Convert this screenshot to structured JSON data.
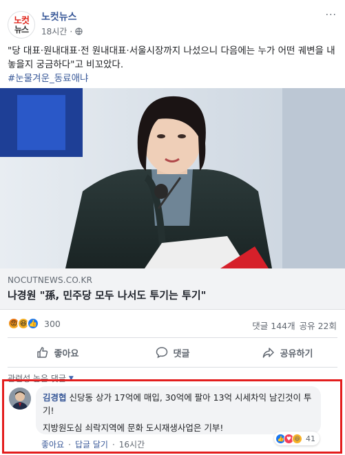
{
  "header": {
    "avatar_line1": "노컷",
    "avatar_line2": "뉴스",
    "page_name": "노컷뉴스",
    "time": "18시간",
    "more": "···"
  },
  "post": {
    "text": "\"당 대표·원내대표·전 원내대표·서울시장까지 나섰으니 다음에는 누가 어떤 궤변을 내놓을지 궁금하다\"고 비꼬았다.",
    "hashtag": "#눈물겨운_동료애냐"
  },
  "link": {
    "domain": "NOCUTNEWS.CO.KR",
    "title": "나경원 \"孫, 민주당 모두 나서도 투기는 투기\""
  },
  "stats": {
    "reaction_count": "300",
    "comments": "댓글 144개",
    "shares": "공유 22회"
  },
  "actions": {
    "like": "좋아요",
    "comment": "댓글",
    "share": "공유하기"
  },
  "comments_filter": "관련성 높은 댓글",
  "comment": {
    "author": "김경협",
    "text": "신당동 상가 17억에 매입, 30억에 팔아 13억 시세차익 남긴것이 투기!",
    "text2": "지방원도심 쇠락지역에 문화 도시재생사업은 기부!",
    "like": "좋아요",
    "reply": "답글 달기",
    "time": "16시간",
    "reaction_count": "41"
  },
  "colors": {
    "link_blue": "#385898",
    "highlight_red": "#e31d1d",
    "like_blue": "#1877f2"
  }
}
